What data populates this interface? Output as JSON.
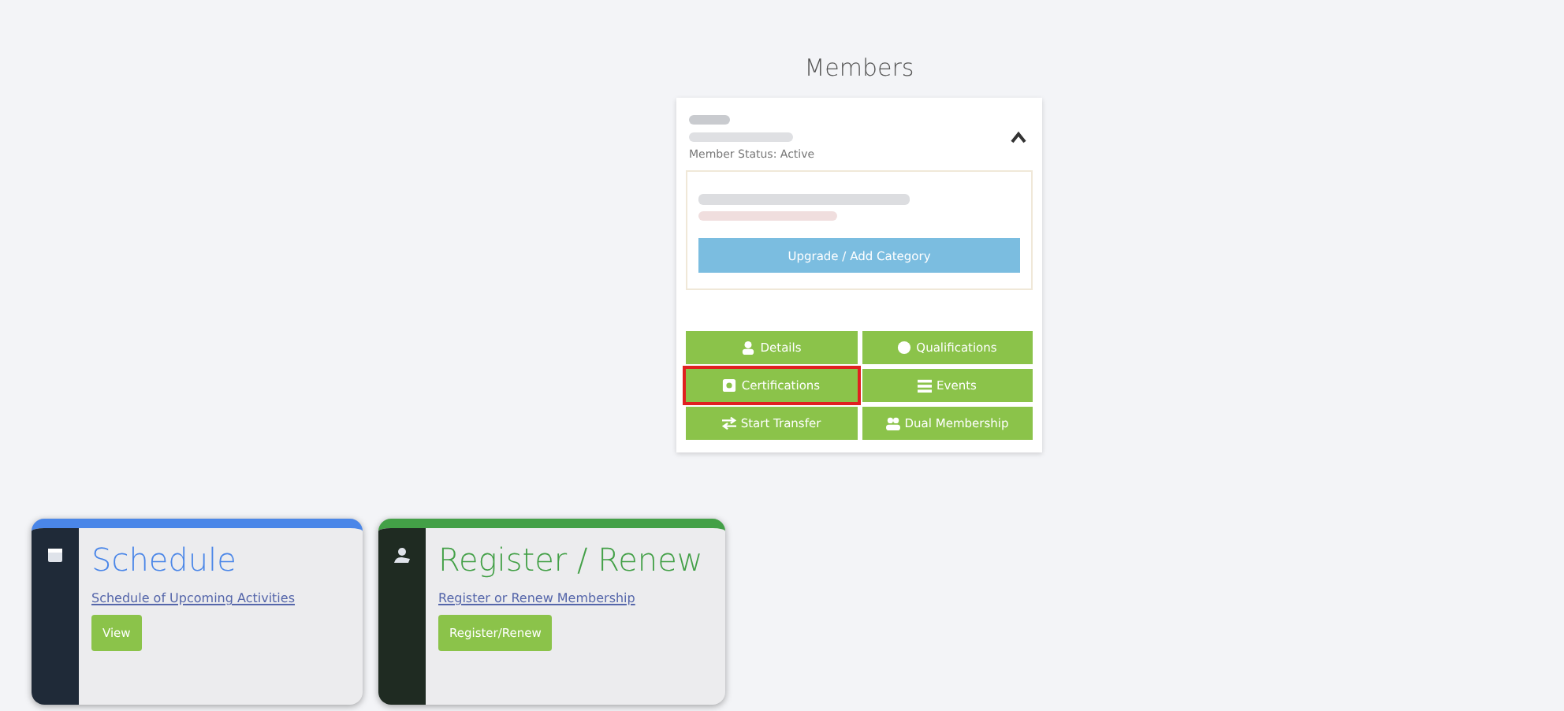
{
  "heading": "Members",
  "member": {
    "expanded": true,
    "status": "Member Status: Active",
    "upgrade_button": "Upgrade / Add Category",
    "actions": [
      {
        "label": "Details",
        "highlighted": false
      },
      {
        "label": "Qualifications",
        "highlighted": false
      },
      {
        "label": "Certifications",
        "highlighted": true
      },
      {
        "label": "Events",
        "highlighted": false
      },
      {
        "label": "Start Transfer",
        "highlighted": false
      },
      {
        "label": "Dual Membership",
        "highlighted": false
      }
    ]
  },
  "tiles": [
    {
      "title": "Schedule",
      "color": "#4a86e8",
      "link": "Schedule of Upcoming Activities",
      "button": "View"
    },
    {
      "title": "Register / Renew",
      "color": "#43a047",
      "link": "Register or Renew Membership",
      "button": "Register/Renew"
    }
  ]
}
